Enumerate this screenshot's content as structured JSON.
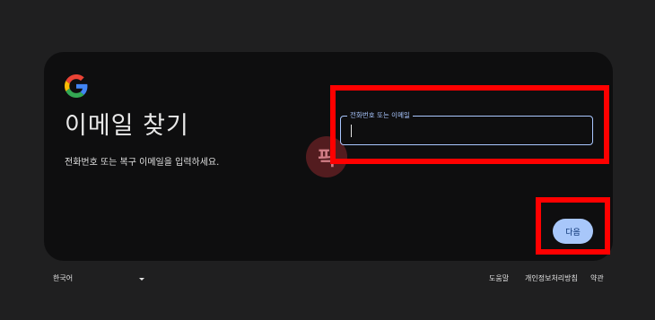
{
  "card": {
    "title": "이메일 찾기",
    "subtitle": "전화번호 또는 복구 이메일을 입력하세요."
  },
  "logo": {
    "name": "google-g-logo"
  },
  "watermark": {
    "text": "픽"
  },
  "field": {
    "label": "전화번호 또는 이메일",
    "value": "",
    "accent_color": "#a9c7ff"
  },
  "next_button": {
    "label": "다음",
    "color": "#a8c7fa"
  },
  "footer": {
    "language": "한국어",
    "links": [
      "도움말",
      "개인정보처리방침",
      "약관"
    ]
  },
  "highlight_color": "#ff0000"
}
